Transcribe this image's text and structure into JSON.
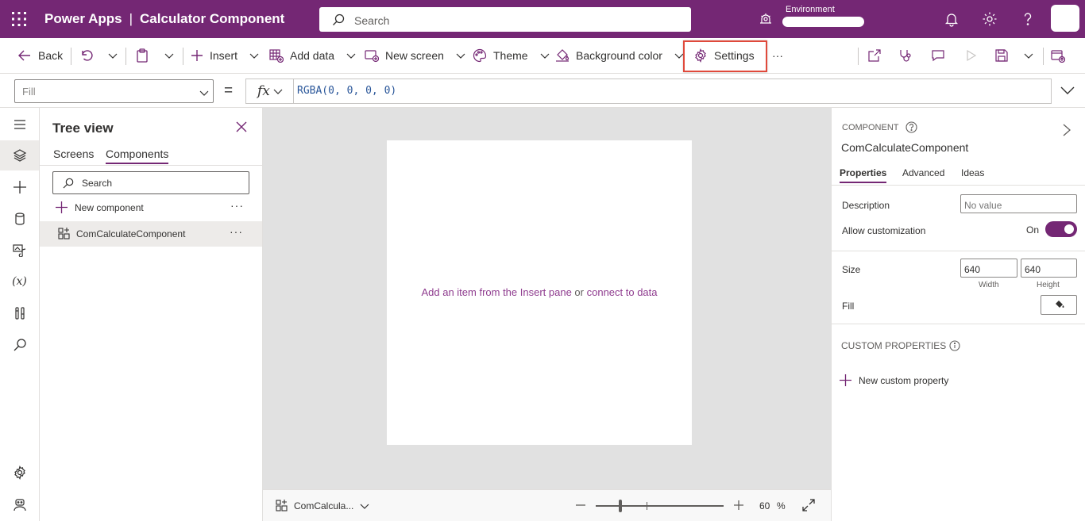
{
  "header": {
    "app_name": "Power Apps",
    "separator": "|",
    "project_name": "Calculator Component",
    "search_placeholder": "Search",
    "environment_label": "Environment"
  },
  "commandbar": {
    "back": "Back",
    "insert": "Insert",
    "add_data": "Add data",
    "new_screen": "New screen",
    "theme": "Theme",
    "background_color": "Background color",
    "settings": "Settings",
    "more": "···"
  },
  "formula_bar": {
    "property": "Fill",
    "equals": "=",
    "fx": "fx",
    "formula": "RGBA(0, 0, 0, 0)"
  },
  "tree_view": {
    "title": "Tree view",
    "tabs": [
      "Screens",
      "Components"
    ],
    "active_tab": "Components",
    "search_placeholder": "Search",
    "new_component": "New component",
    "more": "···",
    "items": [
      {
        "label": "ComCalculateComponent"
      }
    ]
  },
  "canvas": {
    "hint_link1": "Add an item from the Insert pane",
    "hint_or": "or",
    "hint_link2": "connect to data"
  },
  "bottombar": {
    "crumb": "ComCalcula...",
    "zoom_value": "60",
    "zoom_unit": "%",
    "zoom_level": 0.6
  },
  "properties": {
    "caption": "COMPONENT",
    "name": "ComCalculateComponent",
    "tabs": [
      "Properties",
      "Advanced",
      "Ideas"
    ],
    "active_tab": "Properties",
    "description_label": "Description",
    "description_placeholder": "No value",
    "allow_customization_label": "Allow customization",
    "allow_customization_state": "On",
    "size_label": "Size",
    "width_value": "640",
    "height_value": "640",
    "width_sub": "Width",
    "height_sub": "Height",
    "fill_label": "Fill",
    "custom_properties_title": "CUSTOM PROPERTIES",
    "new_custom_property": "New custom property"
  },
  "colors": {
    "brand": "#742774",
    "link": "#8f3c8f",
    "highlight": "#e0493b",
    "canvas_bg": "#e1e1e1"
  }
}
